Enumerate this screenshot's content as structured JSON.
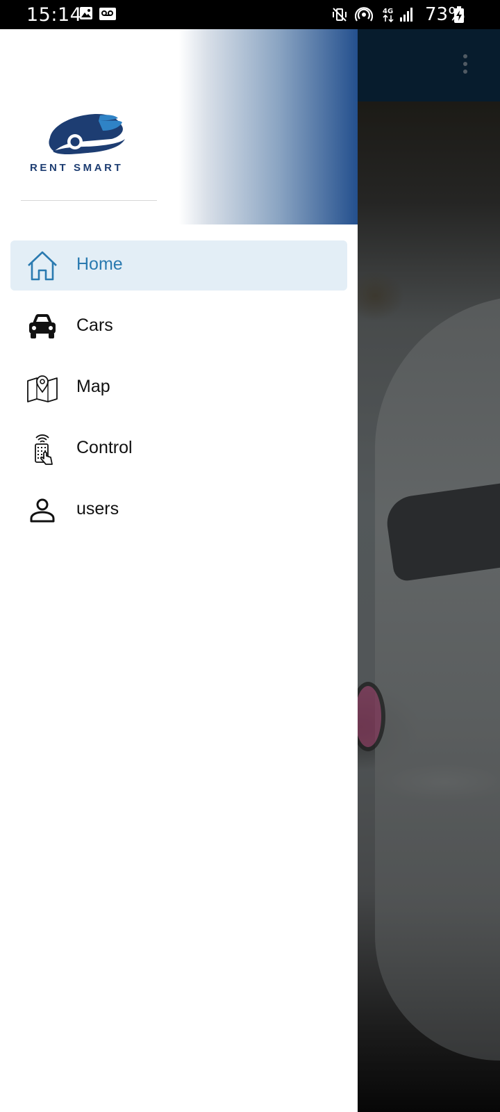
{
  "status_bar": {
    "time": "15:14",
    "battery_percent": "73%",
    "icons": [
      "image-icon",
      "voicemail-icon",
      "vibrate-mute-icon",
      "hotspot-icon",
      "4g-data-icon",
      "signal-icon",
      "battery-charging-icon"
    ]
  },
  "app": {
    "toolbar_color": "#0b2b45",
    "overflow_icon": "more-vertical-icon"
  },
  "drawer": {
    "logo_text": "RENT SMART",
    "brand_color": "#1d3d72",
    "accent_color": "#2a7ab0",
    "active_item_bg": "#e3eef6",
    "items": [
      {
        "label": "Home",
        "icon": "home-icon",
        "active": true
      },
      {
        "label": "Cars",
        "icon": "car-icon",
        "active": false
      },
      {
        "label": "Map",
        "icon": "map-pin-icon",
        "active": false
      },
      {
        "label": "Control",
        "icon": "remote-control-icon",
        "active": false
      },
      {
        "label": "users",
        "icon": "user-icon",
        "active": false
      }
    ]
  }
}
